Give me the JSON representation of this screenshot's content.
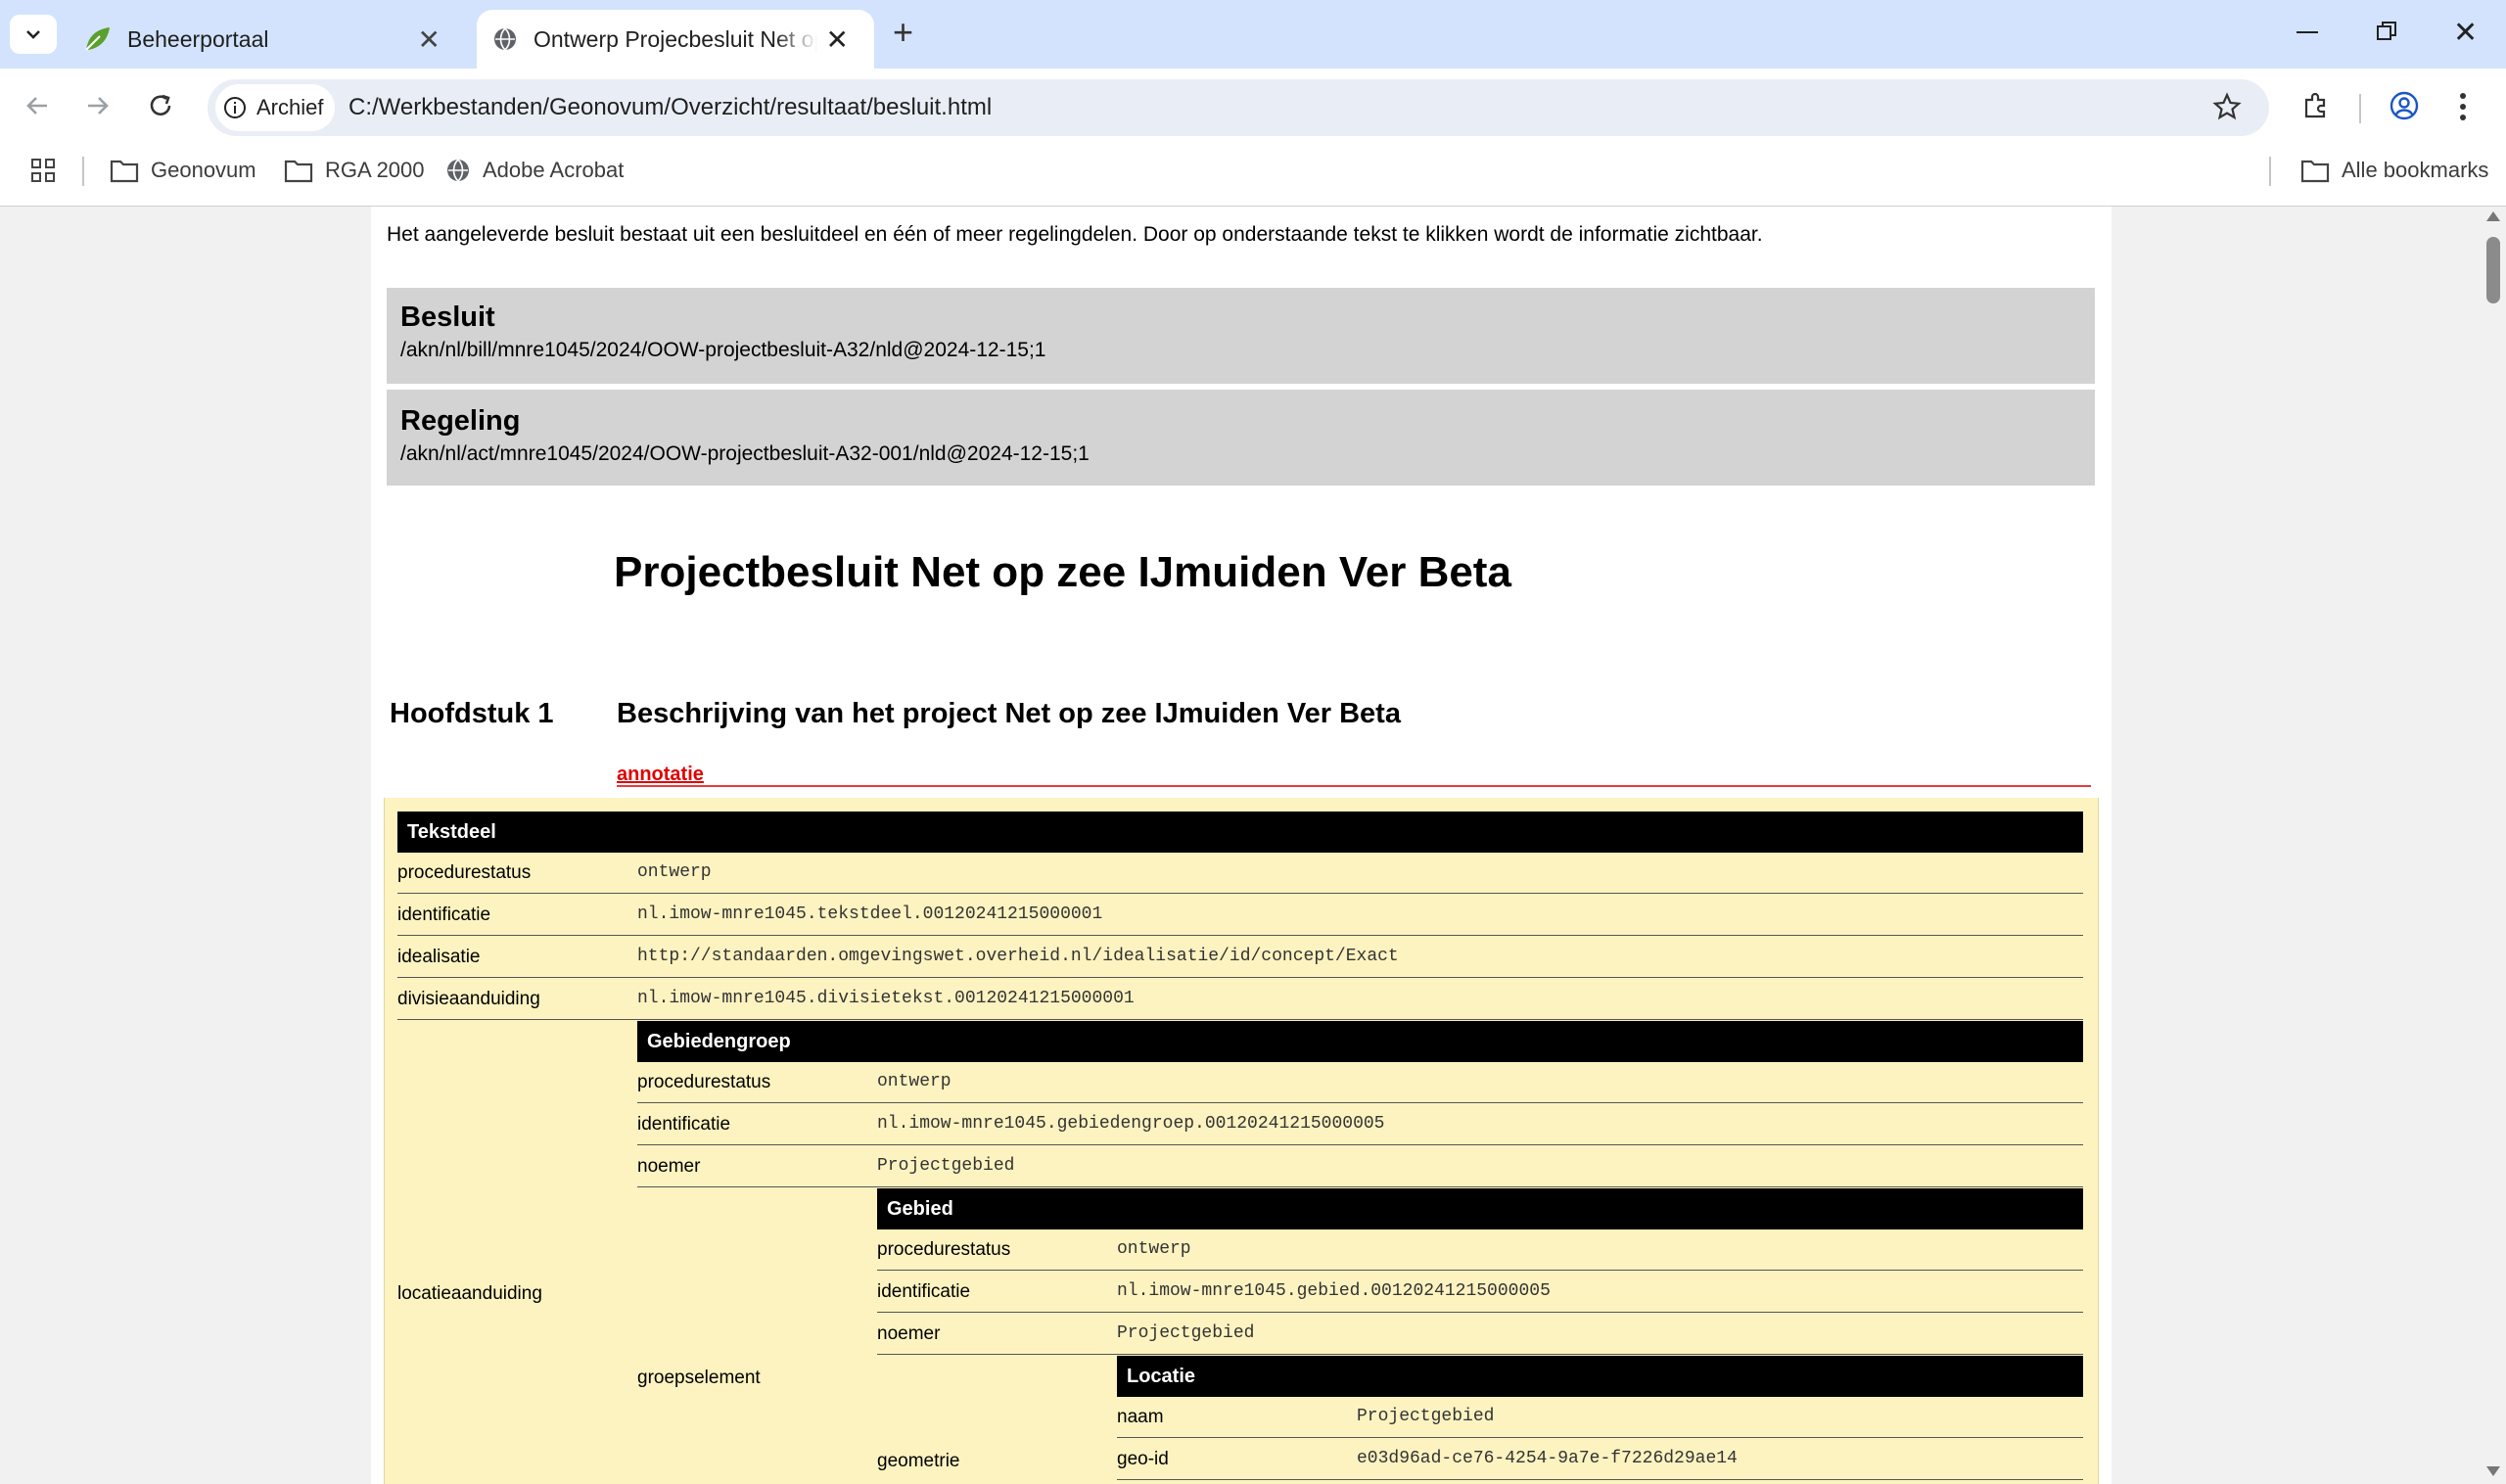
{
  "browser": {
    "tabs": [
      {
        "title": "Beheerportaal",
        "active": false
      },
      {
        "title": "Ontwerp Projecbesluit Net op zee IJmuiden Ver Beta",
        "active": true
      }
    ],
    "new_tab": "+",
    "address": {
      "chip": "Archief",
      "url": "C:/Werkbestanden/Geonovum/Overzicht/resultaat/besluit.html"
    },
    "bookmarks": [
      {
        "label": "Geonovum",
        "icon": "folder-icon"
      },
      {
        "label": "RGA 2000",
        "icon": "folder-icon"
      },
      {
        "label": "Adobe Acrobat",
        "icon": "globe-icon"
      }
    ],
    "all_bookmarks": "Alle bookmarks"
  },
  "page": {
    "intro": "Het aangeleverde besluit bestaat uit een besluitdeel en één of meer regelingdelen. Door op onderstaande tekst te klikken wordt de informatie zichtbaar.",
    "besluit": {
      "title": "Besluit",
      "id": "/akn/nl/bill/mnre1045/2024/OOW-projectbesluit-A32/nld@2024-12-15;1"
    },
    "regeling": {
      "title": "Regeling",
      "id": "/akn/nl/act/mnre1045/2024/OOW-projectbesluit-A32-001/nld@2024-12-15;1"
    },
    "doc_title": "Projectbesluit Net op zee IJmuiden Ver Beta",
    "chapter": {
      "number": "Hoofdstuk 1",
      "title": "Beschrijving van het project Net op zee IJmuiden Ver Beta"
    },
    "annotation_link": "annotatie",
    "tekstdeel": {
      "header": "Tekstdeel",
      "rows": [
        {
          "label": "procedurestatus",
          "value": "ontwerp"
        },
        {
          "label": "identificatie",
          "value": "nl.imow-mnre1045.tekstdeel.00120241215000001"
        },
        {
          "label": "idealisatie",
          "value": "http://standaarden.omgevingswet.overheid.nl/idealisatie/id/concept/Exact"
        },
        {
          "label": "divisieaanduiding",
          "value": "nl.imow-mnre1045.divisietekst.00120241215000001"
        }
      ],
      "locatie_label": "locatieaanduiding",
      "gebiedengroep": {
        "header": "Gebiedengroep",
        "rows": [
          {
            "label": "procedurestatus",
            "value": "ontwerp"
          },
          {
            "label": "identificatie",
            "value": "nl.imow-mnre1045.gebiedengroep.00120241215000005"
          },
          {
            "label": "noemer",
            "value": "Projectgebied"
          }
        ],
        "groep_label": "groepselement",
        "gebied": {
          "header": "Gebied",
          "rows": [
            {
              "label": "procedurestatus",
              "value": "ontwerp"
            },
            {
              "label": "identificatie",
              "value": "nl.imow-mnre1045.gebied.00120241215000005"
            },
            {
              "label": "noemer",
              "value": "Projectgebied"
            }
          ],
          "geometrie_label": "geometrie",
          "locatie": {
            "header": "Locatie",
            "rows": [
              {
                "label": "naam",
                "value": "Projectgebied"
              },
              {
                "label": "geo-id",
                "value": "e03d96ad-ce76-4254-9a7e-f7226d29ae14"
              }
            ]
          }
        }
      }
    }
  }
}
